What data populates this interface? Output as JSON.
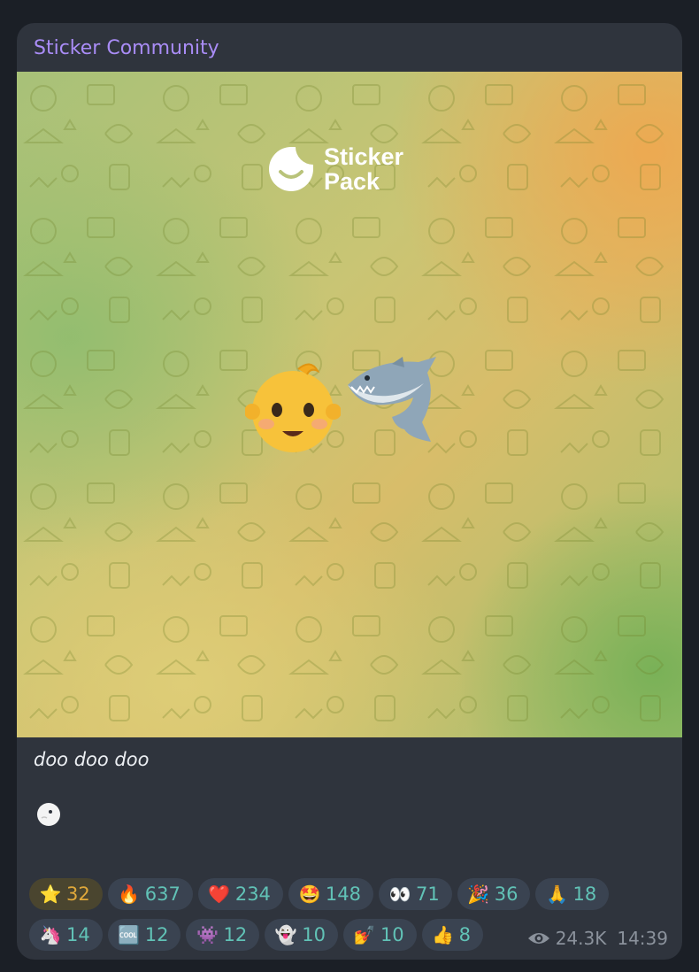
{
  "message": {
    "channel_name": "Sticker Community",
    "media": {
      "logo_text_line1": "Sticker",
      "logo_text_line2": "Pack",
      "stickers": [
        "baby-emoji",
        "shark-emoji"
      ]
    },
    "caption": "doo doo doo",
    "caption_emoji": "new-moon-face",
    "reactions": [
      {
        "emoji": "⭐",
        "name": "star",
        "count": "32"
      },
      {
        "emoji": "🔥",
        "name": "fire",
        "count": "637"
      },
      {
        "emoji": "❤️",
        "name": "heart",
        "count": "234"
      },
      {
        "emoji": "🤩",
        "name": "star-struck",
        "count": "148"
      },
      {
        "emoji": "👀",
        "name": "eyes",
        "count": "71"
      },
      {
        "emoji": "🎉",
        "name": "party-popper",
        "count": "36"
      },
      {
        "emoji": "🙏",
        "name": "folded-hands",
        "count": "18"
      },
      {
        "emoji": "🦄",
        "name": "unicorn",
        "count": "14"
      },
      {
        "emoji": "🆒",
        "name": "cool",
        "count": "12"
      },
      {
        "emoji": "👾",
        "name": "space-invader",
        "count": "12"
      },
      {
        "emoji": "👻",
        "name": "ghost",
        "count": "10"
      },
      {
        "emoji": "💅",
        "name": "nail-polish",
        "count": "10"
      },
      {
        "emoji": "👍",
        "name": "thumbs-up",
        "count": "8"
      }
    ],
    "views": "24.3K",
    "time": "14:39"
  }
}
